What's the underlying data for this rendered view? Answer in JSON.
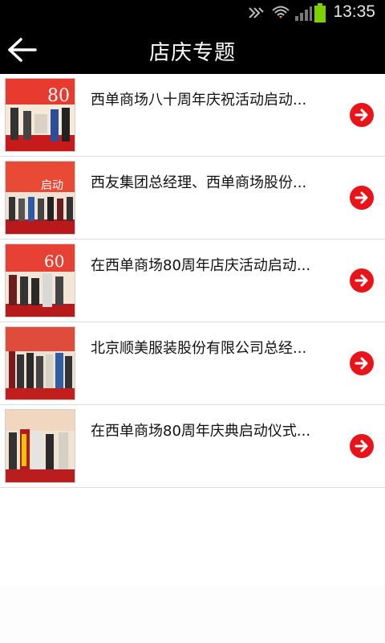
{
  "status": {
    "time": "13:35"
  },
  "header": {
    "title": "店庆专题"
  },
  "items": [
    {
      "title": "西单商场八十周年庆祝活动启动..."
    },
    {
      "title": "西友集团总经理、西单商场股份..."
    },
    {
      "title": "在西单商场80周年店庆活动启动..."
    },
    {
      "title": "北京顺美服装股份有限公司总经..."
    },
    {
      "title": "在西单商场80周年庆典启动仪式..."
    }
  ],
  "colors": {
    "accent": "#e8141a",
    "bar": "#000000"
  }
}
